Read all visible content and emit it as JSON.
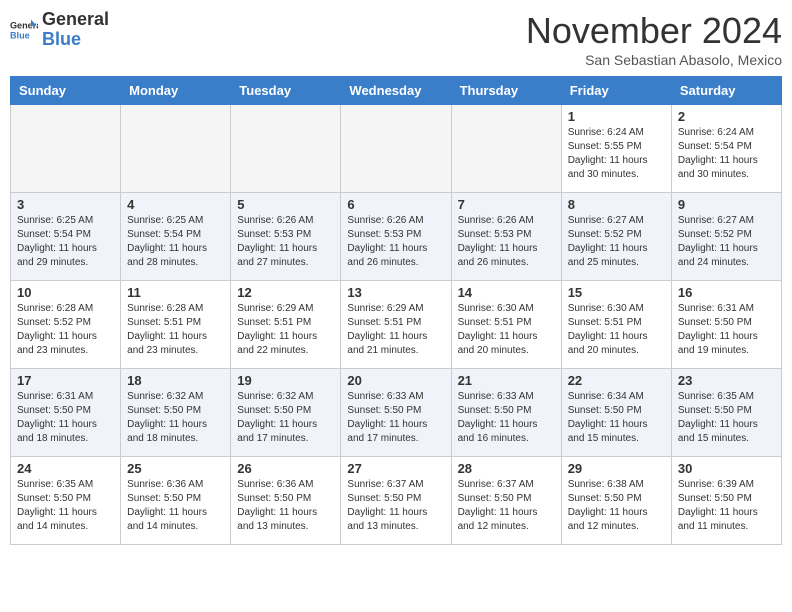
{
  "header": {
    "logo": {
      "general": "General",
      "blue": "Blue"
    },
    "title": "November 2024",
    "location": "San Sebastian Abasolo, Mexico"
  },
  "days_of_week": [
    "Sunday",
    "Monday",
    "Tuesday",
    "Wednesday",
    "Thursday",
    "Friday",
    "Saturday"
  ],
  "weeks": [
    [
      {
        "day": "",
        "info": ""
      },
      {
        "day": "",
        "info": ""
      },
      {
        "day": "",
        "info": ""
      },
      {
        "day": "",
        "info": ""
      },
      {
        "day": "",
        "info": ""
      },
      {
        "day": "1",
        "info": "Sunrise: 6:24 AM\nSunset: 5:55 PM\nDaylight: 11 hours and 30 minutes."
      },
      {
        "day": "2",
        "info": "Sunrise: 6:24 AM\nSunset: 5:54 PM\nDaylight: 11 hours and 30 minutes."
      }
    ],
    [
      {
        "day": "3",
        "info": "Sunrise: 6:25 AM\nSunset: 5:54 PM\nDaylight: 11 hours and 29 minutes."
      },
      {
        "day": "4",
        "info": "Sunrise: 6:25 AM\nSunset: 5:54 PM\nDaylight: 11 hours and 28 minutes."
      },
      {
        "day": "5",
        "info": "Sunrise: 6:26 AM\nSunset: 5:53 PM\nDaylight: 11 hours and 27 minutes."
      },
      {
        "day": "6",
        "info": "Sunrise: 6:26 AM\nSunset: 5:53 PM\nDaylight: 11 hours and 26 minutes."
      },
      {
        "day": "7",
        "info": "Sunrise: 6:26 AM\nSunset: 5:53 PM\nDaylight: 11 hours and 26 minutes."
      },
      {
        "day": "8",
        "info": "Sunrise: 6:27 AM\nSunset: 5:52 PM\nDaylight: 11 hours and 25 minutes."
      },
      {
        "day": "9",
        "info": "Sunrise: 6:27 AM\nSunset: 5:52 PM\nDaylight: 11 hours and 24 minutes."
      }
    ],
    [
      {
        "day": "10",
        "info": "Sunrise: 6:28 AM\nSunset: 5:52 PM\nDaylight: 11 hours and 23 minutes."
      },
      {
        "day": "11",
        "info": "Sunrise: 6:28 AM\nSunset: 5:51 PM\nDaylight: 11 hours and 23 minutes."
      },
      {
        "day": "12",
        "info": "Sunrise: 6:29 AM\nSunset: 5:51 PM\nDaylight: 11 hours and 22 minutes."
      },
      {
        "day": "13",
        "info": "Sunrise: 6:29 AM\nSunset: 5:51 PM\nDaylight: 11 hours and 21 minutes."
      },
      {
        "day": "14",
        "info": "Sunrise: 6:30 AM\nSunset: 5:51 PM\nDaylight: 11 hours and 20 minutes."
      },
      {
        "day": "15",
        "info": "Sunrise: 6:30 AM\nSunset: 5:51 PM\nDaylight: 11 hours and 20 minutes."
      },
      {
        "day": "16",
        "info": "Sunrise: 6:31 AM\nSunset: 5:50 PM\nDaylight: 11 hours and 19 minutes."
      }
    ],
    [
      {
        "day": "17",
        "info": "Sunrise: 6:31 AM\nSunset: 5:50 PM\nDaylight: 11 hours and 18 minutes."
      },
      {
        "day": "18",
        "info": "Sunrise: 6:32 AM\nSunset: 5:50 PM\nDaylight: 11 hours and 18 minutes."
      },
      {
        "day": "19",
        "info": "Sunrise: 6:32 AM\nSunset: 5:50 PM\nDaylight: 11 hours and 17 minutes."
      },
      {
        "day": "20",
        "info": "Sunrise: 6:33 AM\nSunset: 5:50 PM\nDaylight: 11 hours and 17 minutes."
      },
      {
        "day": "21",
        "info": "Sunrise: 6:33 AM\nSunset: 5:50 PM\nDaylight: 11 hours and 16 minutes."
      },
      {
        "day": "22",
        "info": "Sunrise: 6:34 AM\nSunset: 5:50 PM\nDaylight: 11 hours and 15 minutes."
      },
      {
        "day": "23",
        "info": "Sunrise: 6:35 AM\nSunset: 5:50 PM\nDaylight: 11 hours and 15 minutes."
      }
    ],
    [
      {
        "day": "24",
        "info": "Sunrise: 6:35 AM\nSunset: 5:50 PM\nDaylight: 11 hours and 14 minutes."
      },
      {
        "day": "25",
        "info": "Sunrise: 6:36 AM\nSunset: 5:50 PM\nDaylight: 11 hours and 14 minutes."
      },
      {
        "day": "26",
        "info": "Sunrise: 6:36 AM\nSunset: 5:50 PM\nDaylight: 11 hours and 13 minutes."
      },
      {
        "day": "27",
        "info": "Sunrise: 6:37 AM\nSunset: 5:50 PM\nDaylight: 11 hours and 13 minutes."
      },
      {
        "day": "28",
        "info": "Sunrise: 6:37 AM\nSunset: 5:50 PM\nDaylight: 11 hours and 12 minutes."
      },
      {
        "day": "29",
        "info": "Sunrise: 6:38 AM\nSunset: 5:50 PM\nDaylight: 11 hours and 12 minutes."
      },
      {
        "day": "30",
        "info": "Sunrise: 6:39 AM\nSunset: 5:50 PM\nDaylight: 11 hours and 11 minutes."
      }
    ]
  ]
}
